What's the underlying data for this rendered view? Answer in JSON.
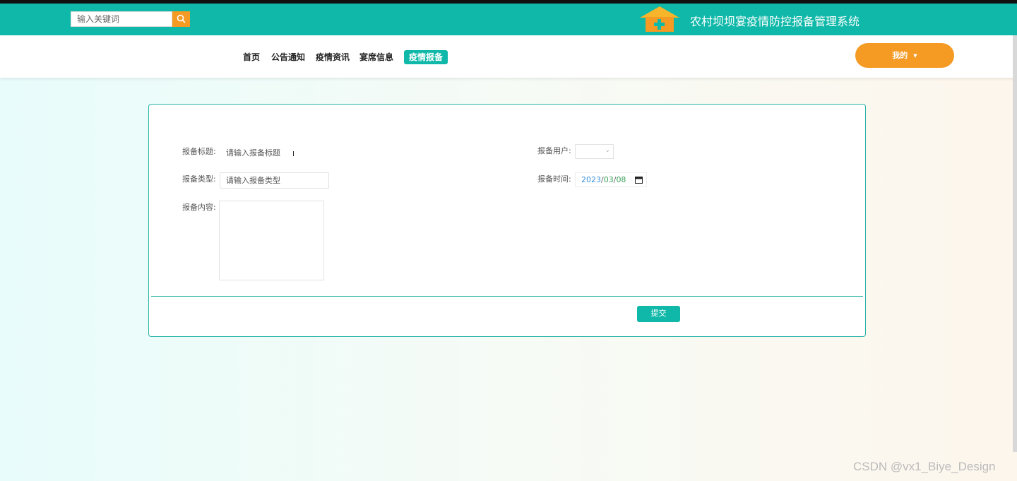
{
  "header": {
    "search_placeholder": "输入关键词",
    "site_title": "农村坝坝宴疫情防控报备管理系统"
  },
  "nav": {
    "items": [
      {
        "label": "首页"
      },
      {
        "label": "公告通知"
      },
      {
        "label": "疫情资讯"
      },
      {
        "label": "宴席信息"
      },
      {
        "label": "疫情报备"
      }
    ],
    "active": "疫情报备",
    "my_label": "我的"
  },
  "form": {
    "title_label": "报备标题:",
    "title_placeholder": "请输入报备标题",
    "type_label": "报备类型:",
    "type_placeholder": "请输入报备类型",
    "content_label": "报备内容:",
    "user_label": "报备用户:",
    "time_label": "报备时间:",
    "date_year": "2023",
    "date_month": "03",
    "date_day": "08",
    "submit_label": "提交"
  },
  "watermark": "CSDN @vx1_Biye_Design",
  "colors": {
    "primary": "#0fb8a8",
    "accent": "#f59a23"
  }
}
